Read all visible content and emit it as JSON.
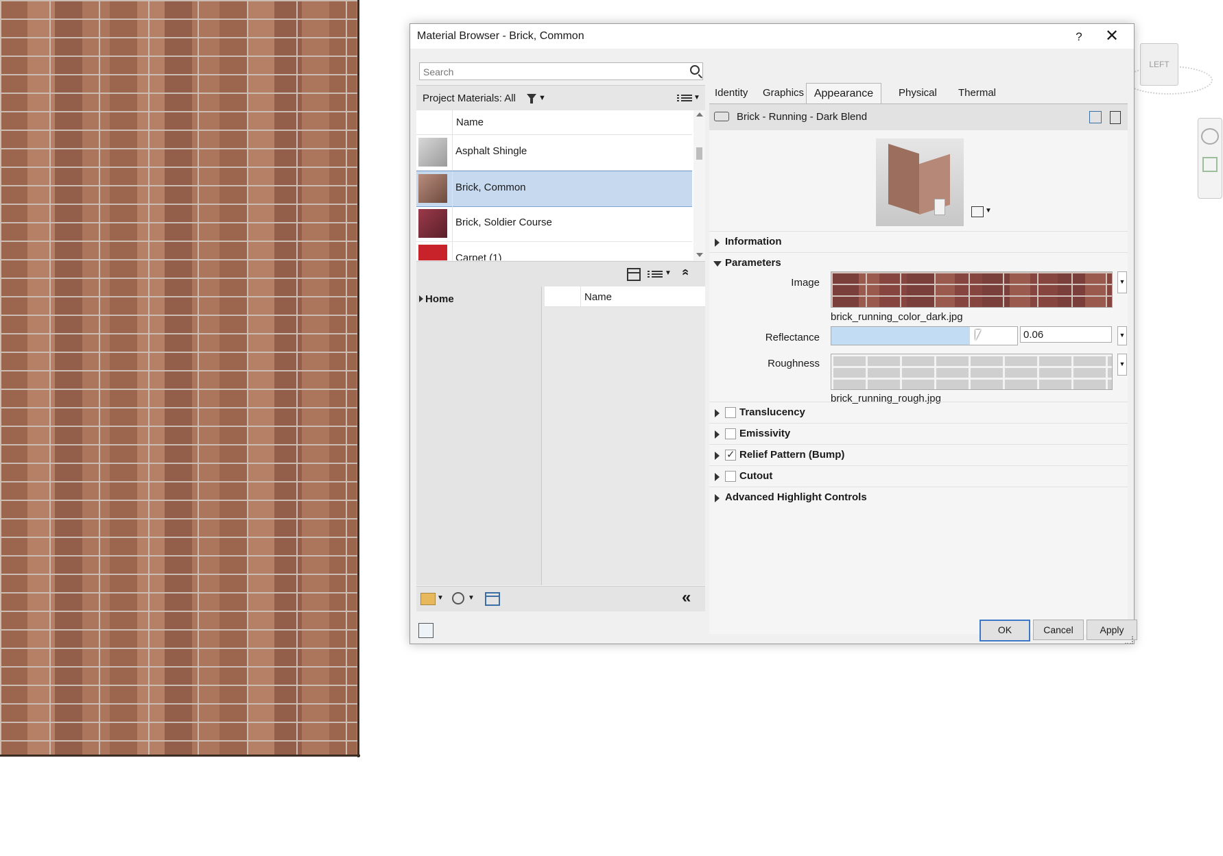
{
  "window": {
    "title": "Material Browser - Brick, Common",
    "help_label": "?",
    "close_label": "✕"
  },
  "viewport": {
    "viewcube_label": "LEFT"
  },
  "browser": {
    "search_placeholder": "Search",
    "filter_label": "Project Materials: All",
    "list_header": "Name",
    "materials": [
      {
        "name": "Asphalt Shingle",
        "selected": false
      },
      {
        "name": "Brick, Common",
        "selected": true
      },
      {
        "name": "Brick, Soldier Course",
        "selected": false
      },
      {
        "name": "Carpet (1)",
        "selected": false
      }
    ],
    "library_tree_root": "Home",
    "library_header": "Name",
    "collapse_label": "«"
  },
  "editor": {
    "tabs": [
      "Identity",
      "Graphics",
      "Appearance",
      "Physical",
      "Thermal"
    ],
    "active_tab": "Appearance",
    "asset_name": "Brick - Running - Dark Blend",
    "sections": {
      "information": "Information",
      "parameters": "Parameters",
      "translucency": "Translucency",
      "emissivity": "Emissivity",
      "relief": "Relief Pattern (Bump)",
      "cutout": "Cutout",
      "advanced": "Advanced Highlight Controls"
    },
    "params": {
      "image_label": "Image",
      "image_file": "brick_running_color_dark.jpg",
      "reflectance_label": "Reflectance",
      "reflectance_value": "0.06",
      "reflectance_fraction": 0.745,
      "roughness_label": "Roughness",
      "roughness_file": "brick_running_rough.jpg"
    },
    "checks": {
      "translucency": false,
      "emissivity": false,
      "relief": true,
      "cutout": false
    }
  },
  "buttons": {
    "ok": "OK",
    "cancel": "Cancel",
    "apply": "Apply"
  }
}
